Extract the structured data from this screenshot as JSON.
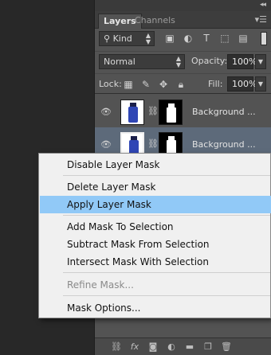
{
  "panel": {
    "collapse_icon": "double-chevron-left-icon",
    "tabs": [
      {
        "label": "Layers",
        "active": true
      },
      {
        "label": "Channels",
        "active": false
      }
    ],
    "menu_icon": "panel-menu-icon"
  },
  "filter": {
    "kind_label": "Kind",
    "icons": [
      "image-filter-icon",
      "adjustment-filter-icon",
      "type-filter-icon",
      "shape-filter-icon",
      "smart-object-filter-icon"
    ]
  },
  "blend": {
    "mode": "Normal",
    "opacity_label": "Opacity:",
    "opacity_value": "100%"
  },
  "lock": {
    "label": "Lock:",
    "fill_label": "Fill:",
    "fill_value": "100%"
  },
  "layers": [
    {
      "name": "Background ...",
      "selected": false
    },
    {
      "name": "Background ...",
      "selected": true
    }
  ],
  "context_menu": {
    "items": [
      {
        "label": "Disable Layer Mask",
        "highlighted": false,
        "disabled": false
      },
      {
        "label": "Delete Layer Mask",
        "highlighted": false,
        "disabled": false
      },
      {
        "label": "Apply Layer Mask",
        "highlighted": true,
        "disabled": false
      },
      {
        "label": "Add Mask To Selection",
        "highlighted": false,
        "disabled": false
      },
      {
        "label": "Subtract Mask From Selection",
        "highlighted": false,
        "disabled": false
      },
      {
        "label": "Intersect Mask With Selection",
        "highlighted": false,
        "disabled": false
      },
      {
        "label": "Refine Mask...",
        "highlighted": false,
        "disabled": true
      },
      {
        "label": "Mask Options...",
        "highlighted": false,
        "disabled": false
      }
    ]
  },
  "colors": {
    "panel_bg": "#535353",
    "selected_layer": "#5d6a7a",
    "menu_highlight": "#91c9f7",
    "menu_bg": "#f0f0f0"
  }
}
